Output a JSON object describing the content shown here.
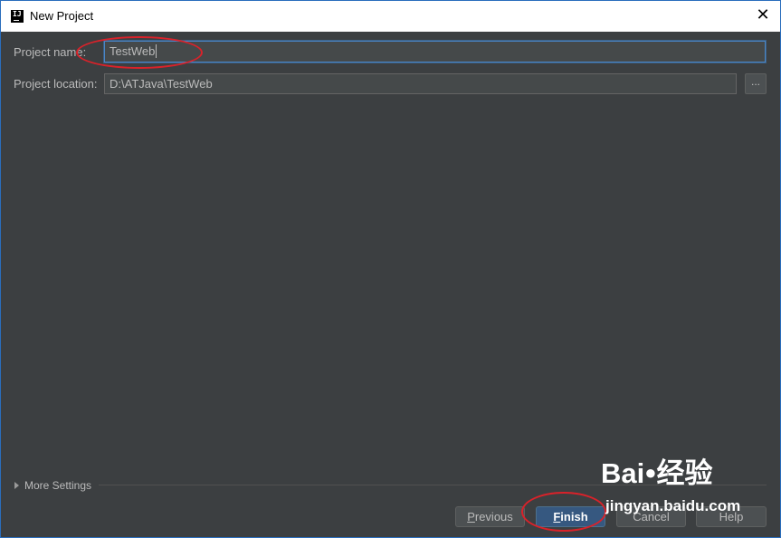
{
  "window": {
    "title": "New Project",
    "close_glyph": "✕",
    "app_icon_text": "IJ"
  },
  "form": {
    "project_name_label": "Project name:",
    "project_name_value": "TestWeb",
    "project_location_label": "Project location:",
    "project_location_value": "D:\\ATJava\\TestWeb",
    "browse_label": "..."
  },
  "more_settings": {
    "label": "More Settings"
  },
  "buttons": {
    "previous": {
      "first": "P",
      "rest": "revious"
    },
    "finish": {
      "first": "F",
      "rest": "inish"
    },
    "cancel": "Cancel",
    "help": "Help"
  },
  "watermark": {
    "logo": "Bai",
    "logo_suffix": "经验",
    "url": "jingyan.baidu.com"
  },
  "colors": {
    "dialog_background": "#3c3f41",
    "focus_border": "#4a86c7",
    "default_button": "#365880",
    "annotation": "#d9222a"
  },
  "icons": {
    "app": "intellij-icon",
    "close": "close-icon",
    "expand": "triangle-right-icon"
  }
}
